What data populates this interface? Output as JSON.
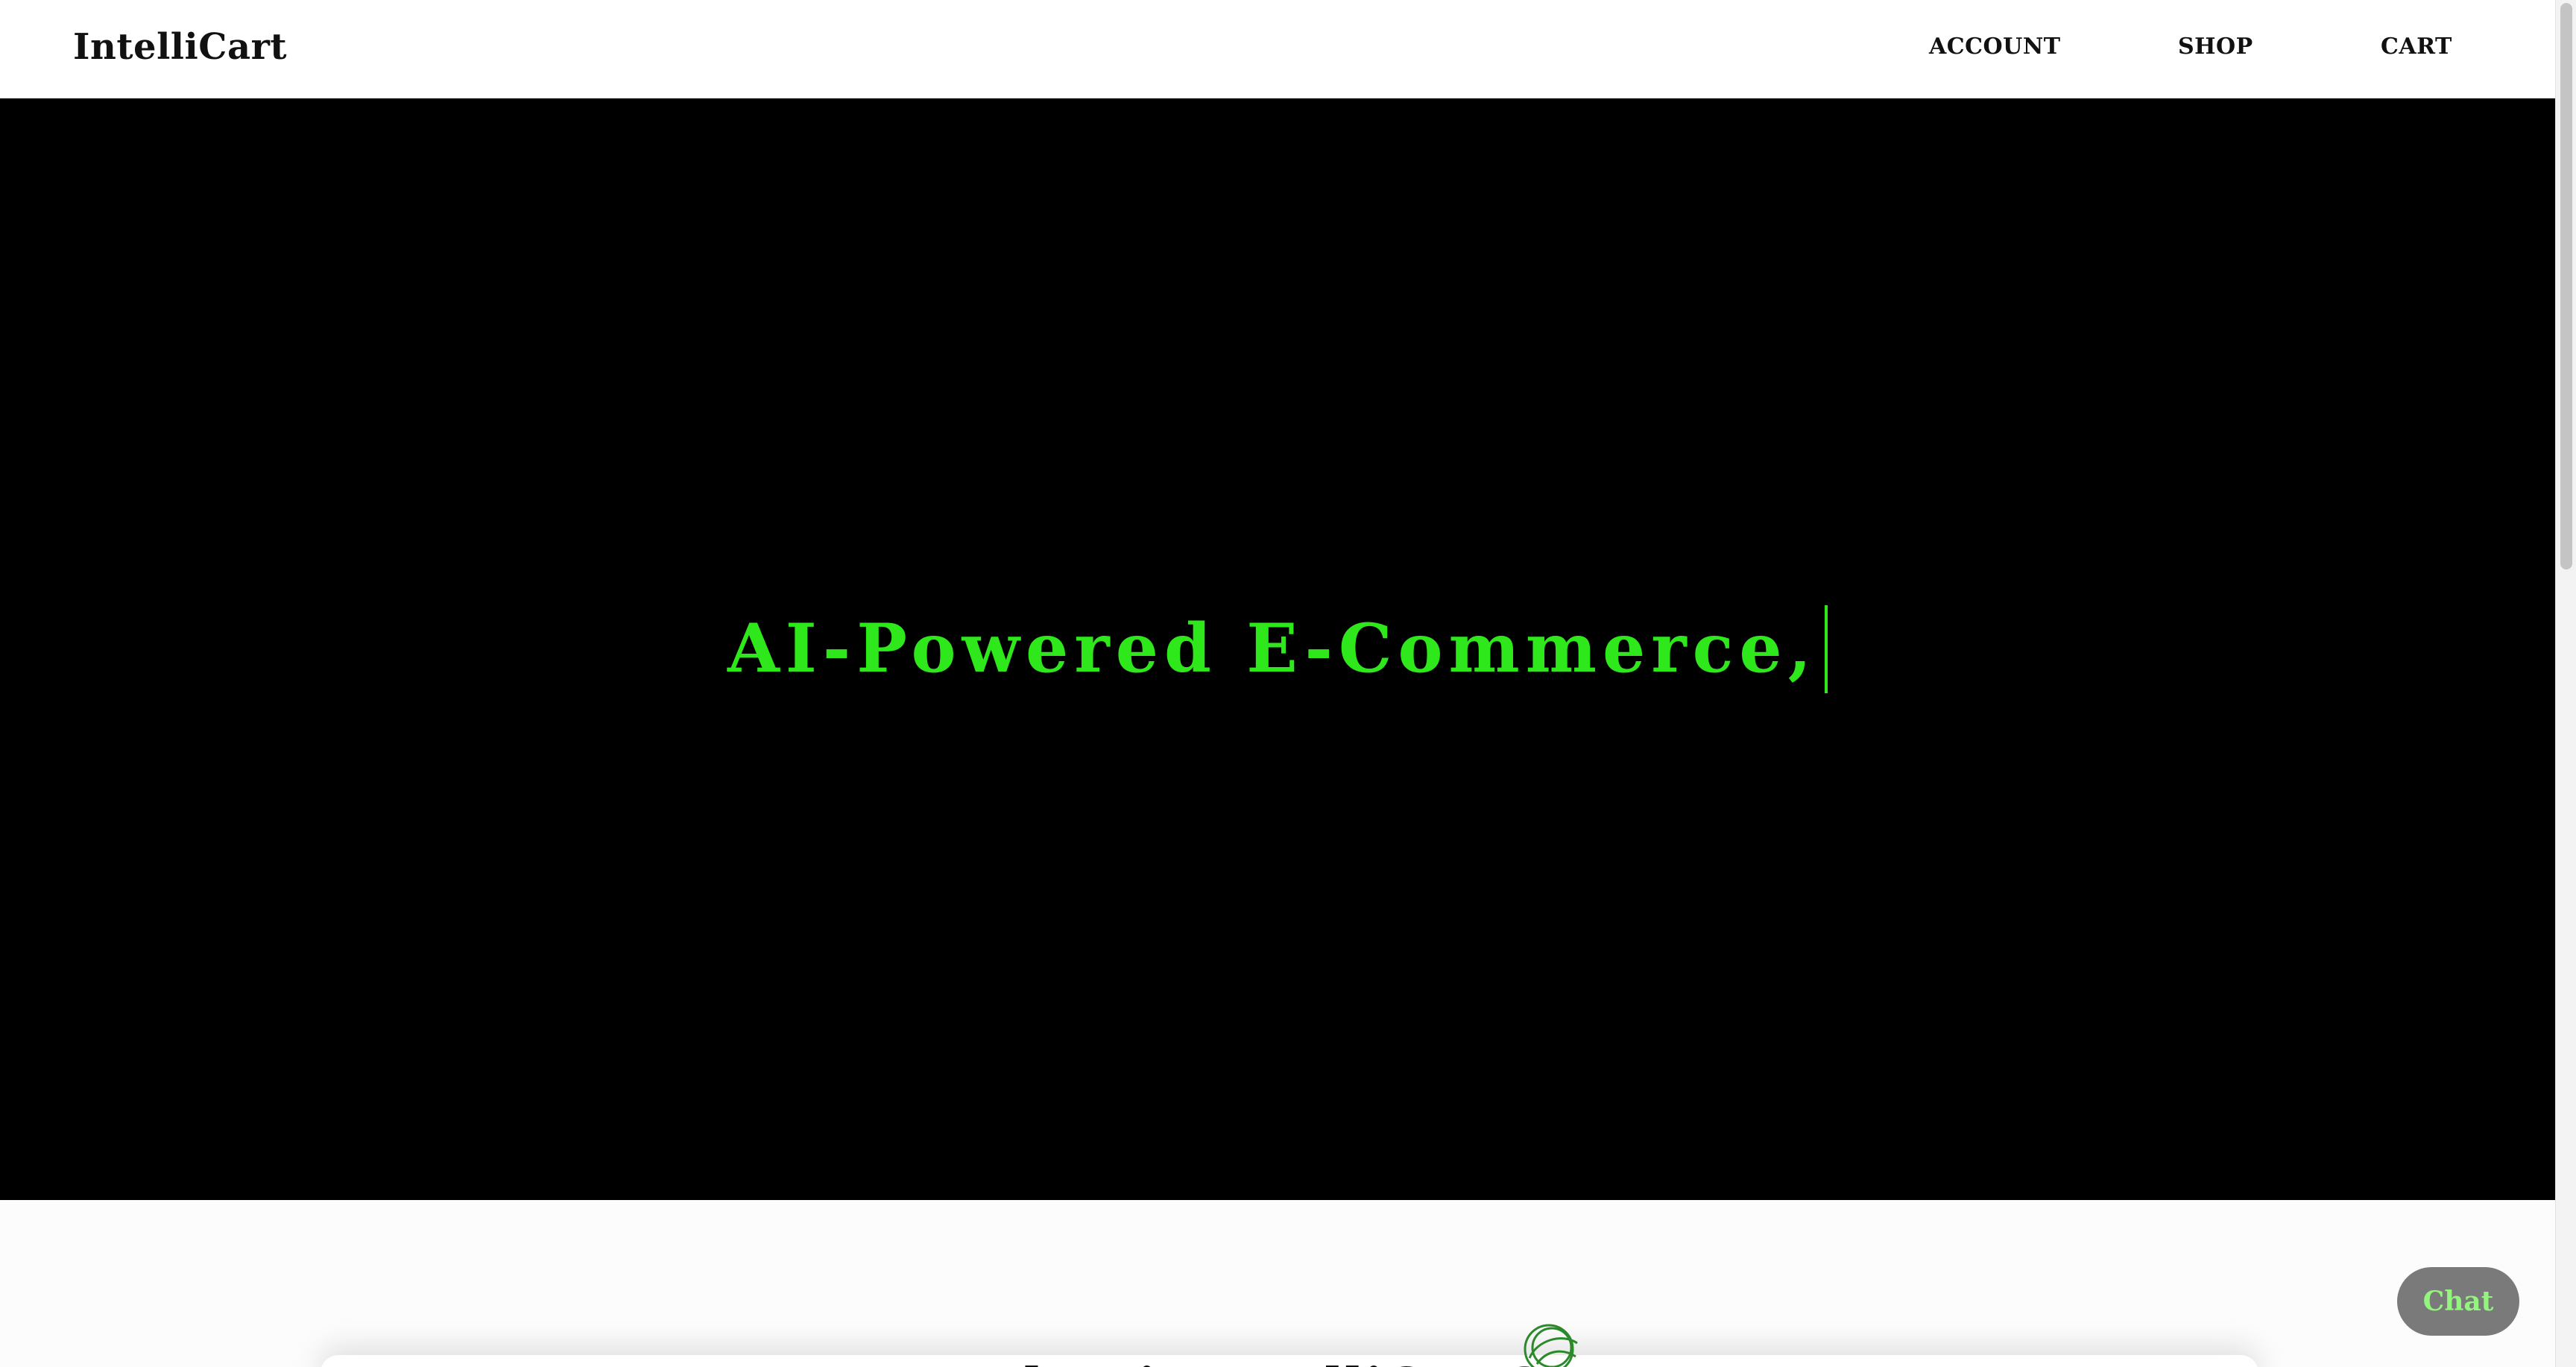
{
  "header": {
    "brand": "IntelliCart",
    "nav": [
      {
        "label": "ACCOUNT"
      },
      {
        "label": "SHOP"
      },
      {
        "label": "CART"
      }
    ]
  },
  "hero": {
    "typed_text": "AI-Powered E-Commerce,"
  },
  "section": {
    "title": "What is IntelliCart?"
  },
  "chat": {
    "label": "Chat"
  },
  "colors": {
    "hero_background": "#000000",
    "hero_text": "#2ee81c",
    "chat_button_bg": "#7a7a7a",
    "chat_button_text": "#93f57e"
  },
  "icons": {
    "section_icon": "swirl-icon"
  }
}
